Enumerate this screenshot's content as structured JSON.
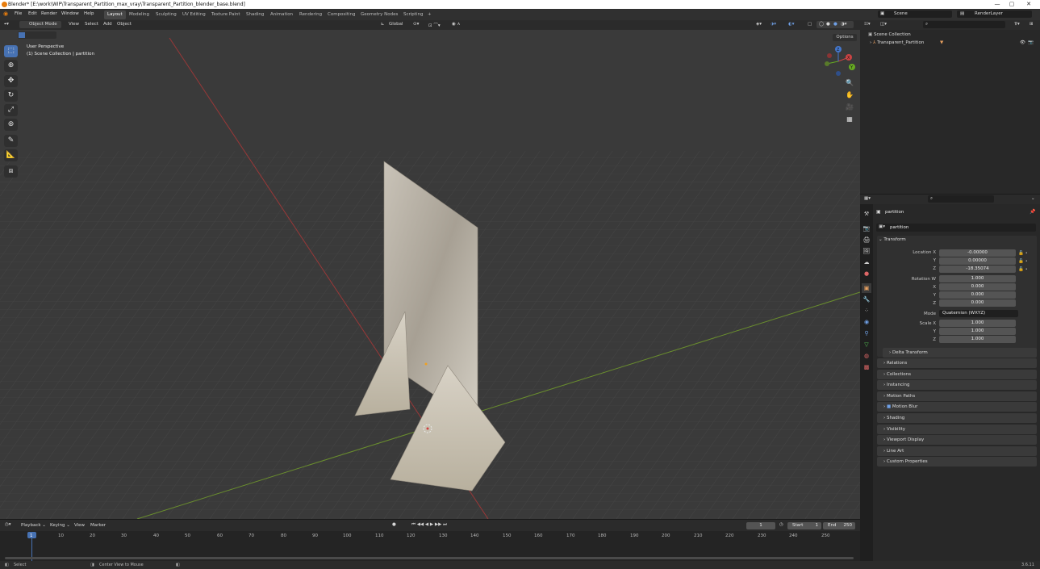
{
  "window": {
    "title": "Blender* [E:\\work\\WIP\\Transparent_Partition_max_vray\\Transparent_Partition_blender_base.blend]",
    "controls": [
      "—",
      "▢",
      "✕"
    ]
  },
  "menubar": {
    "menus": [
      "File",
      "Edit",
      "Render",
      "Window",
      "Help"
    ],
    "workspaces": [
      "Layout",
      "Modeling",
      "Sculpting",
      "UV Editing",
      "Texture Paint",
      "Shading",
      "Animation",
      "Rendering",
      "Compositing",
      "Geometry Nodes",
      "Scripting"
    ],
    "active_workspace": "Layout",
    "add_tab": "+",
    "scene_label": "Scene",
    "view_layer_label": "RenderLayer"
  },
  "viewport_header": {
    "mode": "Object Mode",
    "menus": [
      "View",
      "Select",
      "Add",
      "Object"
    ],
    "transform_orientation": "Global",
    "options": "Options"
  },
  "viewport": {
    "view_name": "User Perspective",
    "collection_info": "(1) Scene Collection | partition",
    "gizmo_axes": [
      "X",
      "Y",
      "Z"
    ],
    "tools": [
      "select-box",
      "cursor",
      "move",
      "rotate",
      "scale",
      "transform",
      "annotate",
      "measure",
      "add-cube"
    ],
    "nav_icons": [
      "zoom-icon",
      "pan-icon",
      "camera-icon",
      "grid-icon"
    ]
  },
  "outliner": {
    "root": "Scene Collection",
    "items": [
      {
        "name": "Transparent_Partition"
      }
    ]
  },
  "properties": {
    "object_name": "partition",
    "data_name": "partition",
    "transform": {
      "header": "Transform",
      "location_label": "Location X",
      "location": [
        "-0.00000",
        "0.00000",
        "-18.35074"
      ],
      "rotation_label": "Rotation W",
      "rotation": [
        "1.000",
        "0.000",
        "0.000",
        "0.000"
      ],
      "mode_label": "Mode",
      "mode_value": "Quaternion (WXYZ)",
      "scale_label": "Scale X",
      "scale": [
        "1.000",
        "1.000",
        "1.000"
      ],
      "axis_labels": [
        "Y",
        "Z",
        "X",
        "Y",
        "Z",
        "Y",
        "Z"
      ]
    },
    "sections": [
      "Delta Transform",
      "Relations",
      "Collections",
      "Instancing",
      "Motion Paths",
      "Motion Blur",
      "Shading",
      "Visibility",
      "Viewport Display",
      "Line Art",
      "Custom Properties"
    ]
  },
  "timeline": {
    "menus": [
      "Playback",
      "Keying",
      "View",
      "Marker"
    ],
    "current_frame": "1",
    "start_label": "Start",
    "start": "1",
    "end_label": "End",
    "end": "250",
    "ticks": [
      "1",
      "10",
      "20",
      "30",
      "40",
      "50",
      "60",
      "70",
      "80",
      "90",
      "100",
      "110",
      "120",
      "130",
      "140",
      "150",
      "160",
      "170",
      "180",
      "190",
      "200",
      "210",
      "220",
      "230",
      "240",
      "250"
    ]
  },
  "statusbar": {
    "left": "Select",
    "middle": "Center View to Mouse",
    "version": "3.6.11"
  }
}
